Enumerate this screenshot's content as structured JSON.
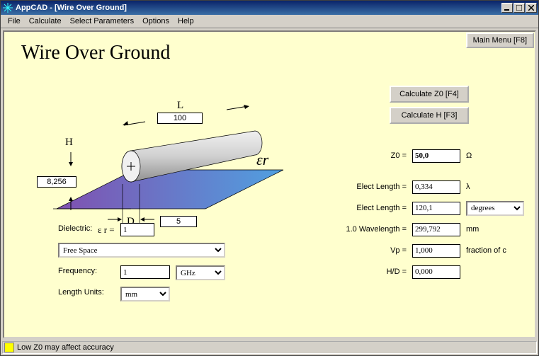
{
  "window": {
    "title": "AppCAD - [Wire Over Ground]"
  },
  "menu": {
    "file": "File",
    "calculate": "Calculate",
    "select_params": "Select Parameters",
    "options": "Options",
    "help": "Help"
  },
  "main_menu_btn": "Main Menu [F8]",
  "page_title": "Wire Over Ground",
  "diagram": {
    "L_label": "L",
    "L_value": "100",
    "H_label": "H",
    "H_value": "8,256",
    "D_label": "D",
    "D_value": "5",
    "er_label": "εr"
  },
  "dielectric_label": "Dielectric:",
  "er_eq": "ε r =",
  "er_value": "1",
  "dielectric_sel": "Free Space",
  "freq_label": "Frequency:",
  "freq_value": "1",
  "freq_unit": "GHz",
  "lenunit_label": "Length Units:",
  "lenunit": "mm",
  "btn_calc_z0": "Calculate Z0  [F4]",
  "btn_calc_h": "Calculate H  [F3]",
  "results": {
    "z0_lbl": "Z0 =",
    "z0_val": "50,0",
    "z0_unit": "Ω",
    "el1_lbl": "Elect Length =",
    "el1_val": "0,334",
    "el1_unit": "λ",
    "el2_lbl": "Elect Length =",
    "el2_val": "120,1",
    "el2_unit": "degrees",
    "wav_lbl": "1.0 Wavelength =",
    "wav_val": "299,792",
    "wav_unit": "mm",
    "vp_lbl": "Vp =",
    "vp_val": "1,000",
    "vp_unit": "fraction of c",
    "hd_lbl": "H/D =",
    "hd_val": "0,000"
  },
  "status": "Low Z0 may affect accuracy"
}
